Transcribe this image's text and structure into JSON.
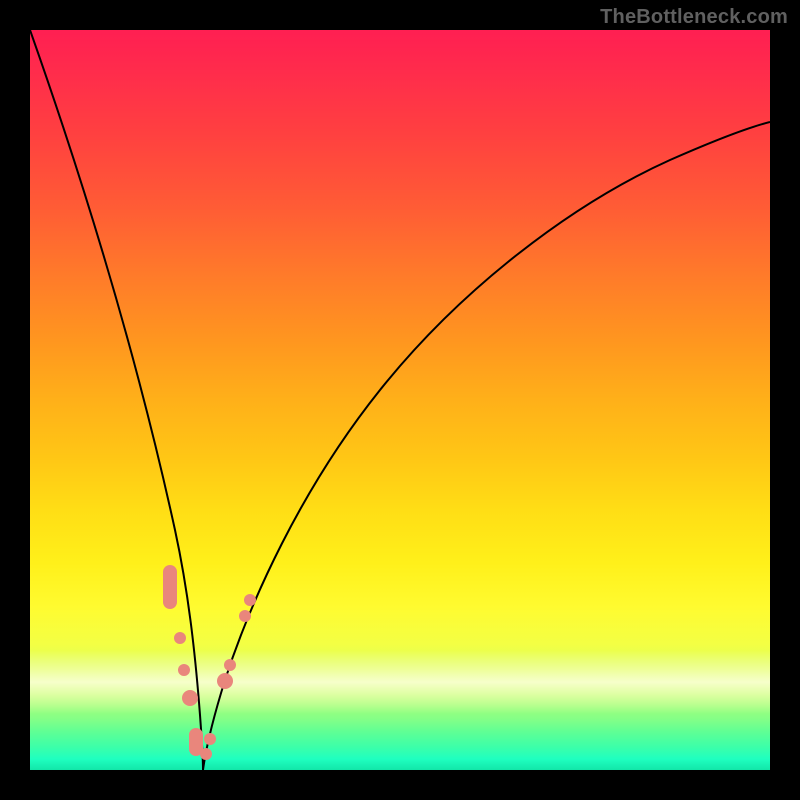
{
  "watermark": "TheBottleneck.com",
  "chart_data": {
    "type": "line",
    "title": "",
    "xlabel": "",
    "ylabel": "",
    "xlim": [
      0,
      1
    ],
    "ylim": [
      0,
      1
    ],
    "legend": false,
    "grid": false,
    "background": "red-yellow-green vertical gradient",
    "series": [
      {
        "name": "left-branch",
        "x": [
          0.0,
          0.03,
          0.06,
          0.09,
          0.12,
          0.15,
          0.17,
          0.19,
          0.2,
          0.21,
          0.215,
          0.22,
          0.225,
          0.23
        ],
        "y": [
          1.0,
          0.9,
          0.8,
          0.68,
          0.56,
          0.44,
          0.34,
          0.25,
          0.18,
          0.12,
          0.08,
          0.05,
          0.02,
          0.0
        ]
      },
      {
        "name": "right-branch",
        "x": [
          0.23,
          0.25,
          0.27,
          0.3,
          0.34,
          0.4,
          0.48,
          0.58,
          0.7,
          0.82,
          0.91,
          1.0
        ],
        "y": [
          0.0,
          0.07,
          0.14,
          0.23,
          0.33,
          0.45,
          0.57,
          0.67,
          0.76,
          0.82,
          0.86,
          0.88
        ]
      }
    ],
    "markers": [
      {
        "branch": "left",
        "x": 0.188,
        "y": 0.245,
        "shape": "pill-tall"
      },
      {
        "branch": "left",
        "x": 0.201,
        "y": 0.176,
        "shape": "round"
      },
      {
        "branch": "left",
        "x": 0.208,
        "y": 0.13,
        "shape": "round"
      },
      {
        "branch": "left",
        "x": 0.214,
        "y": 0.092,
        "shape": "round-big"
      },
      {
        "branch": "left",
        "x": 0.223,
        "y": 0.028,
        "shape": "pill"
      },
      {
        "branch": "right",
        "x": 0.236,
        "y": 0.02,
        "shape": "round"
      },
      {
        "branch": "right",
        "x": 0.242,
        "y": 0.042,
        "shape": "round"
      },
      {
        "branch": "right",
        "x": 0.264,
        "y": 0.12,
        "shape": "round-big"
      },
      {
        "branch": "right",
        "x": 0.269,
        "y": 0.142,
        "shape": "round"
      },
      {
        "branch": "right",
        "x": 0.29,
        "y": 0.208,
        "shape": "round"
      },
      {
        "branch": "right",
        "x": 0.296,
        "y": 0.228,
        "shape": "round"
      }
    ],
    "marker_color": "#e9867c"
  }
}
